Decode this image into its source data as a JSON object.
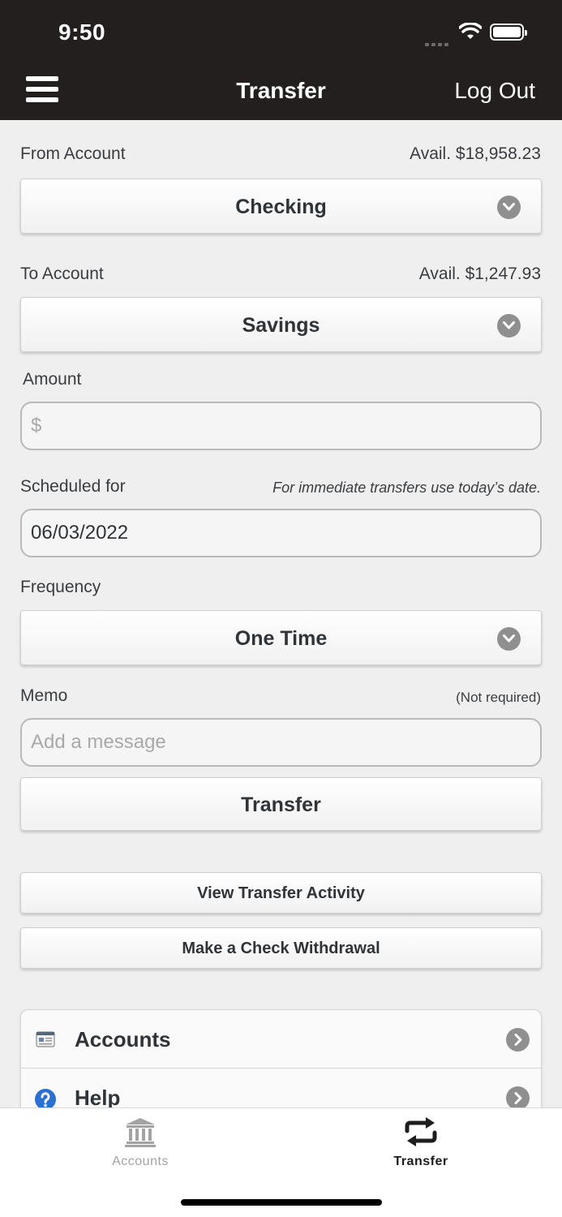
{
  "status_bar": {
    "time": "9:50"
  },
  "nav": {
    "title": "Transfer",
    "logout_label": "Log Out"
  },
  "from_account": {
    "label": "From Account",
    "available": "Avail. $18,958.23",
    "selected": "Checking"
  },
  "to_account": {
    "label": "To Account",
    "available": "Avail. $1,247.93",
    "selected": "Savings"
  },
  "amount": {
    "label": "Amount",
    "placeholder": "$"
  },
  "schedule": {
    "label": "Scheduled for",
    "note": "For immediate transfers use today’s date.",
    "value": "06/03/2022"
  },
  "frequency": {
    "label": "Frequency",
    "selected": "One Time"
  },
  "memo": {
    "label": "Memo",
    "note": "(Not required)",
    "placeholder": "Add a message"
  },
  "buttons": {
    "transfer": "Transfer",
    "view_activity": "View Transfer Activity",
    "check_withdrawal": "Make a Check Withdrawal"
  },
  "menu": {
    "items": [
      {
        "label": "Accounts",
        "icon": "accounts-card-icon"
      },
      {
        "label": "Help",
        "icon": "help-icon"
      }
    ]
  },
  "tab_bar": {
    "tabs": [
      {
        "label": "Accounts",
        "icon": "bank-icon",
        "active": false
      },
      {
        "label": "Transfer",
        "icon": "transfer-arrows-icon",
        "active": true
      }
    ]
  },
  "colors": {
    "header_bg": "#231f1f",
    "page_bg": "#efefef",
    "help_icon": "#2b6fd1",
    "inactive_tab": "#a3a3a3"
  }
}
